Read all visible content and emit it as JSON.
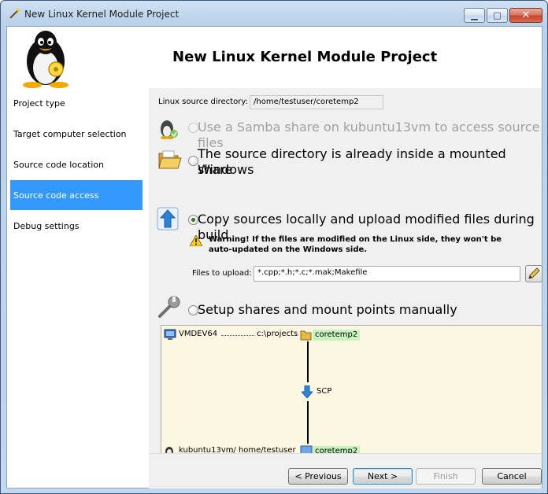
{
  "window": {
    "title": "New Linux Kernel Module Project",
    "controls": {
      "minimize": "▁",
      "maximize": "□",
      "close": "✕"
    }
  },
  "header": {
    "title": "New Linux Kernel Module Project"
  },
  "sidebar": {
    "items": [
      {
        "label": "Project type",
        "active": false
      },
      {
        "label": "Target computer selection",
        "active": false
      },
      {
        "label": "Source code location",
        "active": false
      },
      {
        "label": "Source code access",
        "active": true
      },
      {
        "label": "Debug settings",
        "active": false
      }
    ]
  },
  "main": {
    "source_dir_label": "Linux source directory:",
    "source_dir_value": "/home/testuser/coretemp2",
    "options": [
      {
        "label": "Use a Samba share on kubuntu13vm to access source files",
        "checked": false,
        "disabled": true
      },
      {
        "label_line1": "The source directory is already inside a mounted Windows",
        "label_line2": "share",
        "checked": false,
        "disabled": false
      },
      {
        "label": "Copy sources locally and upload modified files during build",
        "checked": true,
        "disabled": false
      },
      {
        "label": "Setup shares and mount points manually",
        "checked": false,
        "disabled": false
      }
    ],
    "warning_line1": "Warning! If the files are modified on the Linux side, they won't be",
    "warning_line2": "auto-updated on the Windows side.",
    "files_label": "Files to upload:",
    "files_value": "*.cpp;*.h;*.c;*.mak;Makefile"
  },
  "diagram": {
    "windows_host": "VMDEV64",
    "windows_path": "c:\\projects",
    "windows_folder": "coretemp2",
    "transfer": "SCP",
    "linux_host": "kubuntu13vm",
    "linux_path": ":/ home/testuser",
    "linux_folder": "coretemp2"
  },
  "footer": {
    "previous": "< Previous",
    "next": "Next >",
    "finish": "Finish",
    "cancel": "Cancel"
  },
  "colors": {
    "sidebar_active": "#3399ff",
    "diagram_bg": "#fbf7e3",
    "folder_highlight": "#c7f3c0"
  }
}
